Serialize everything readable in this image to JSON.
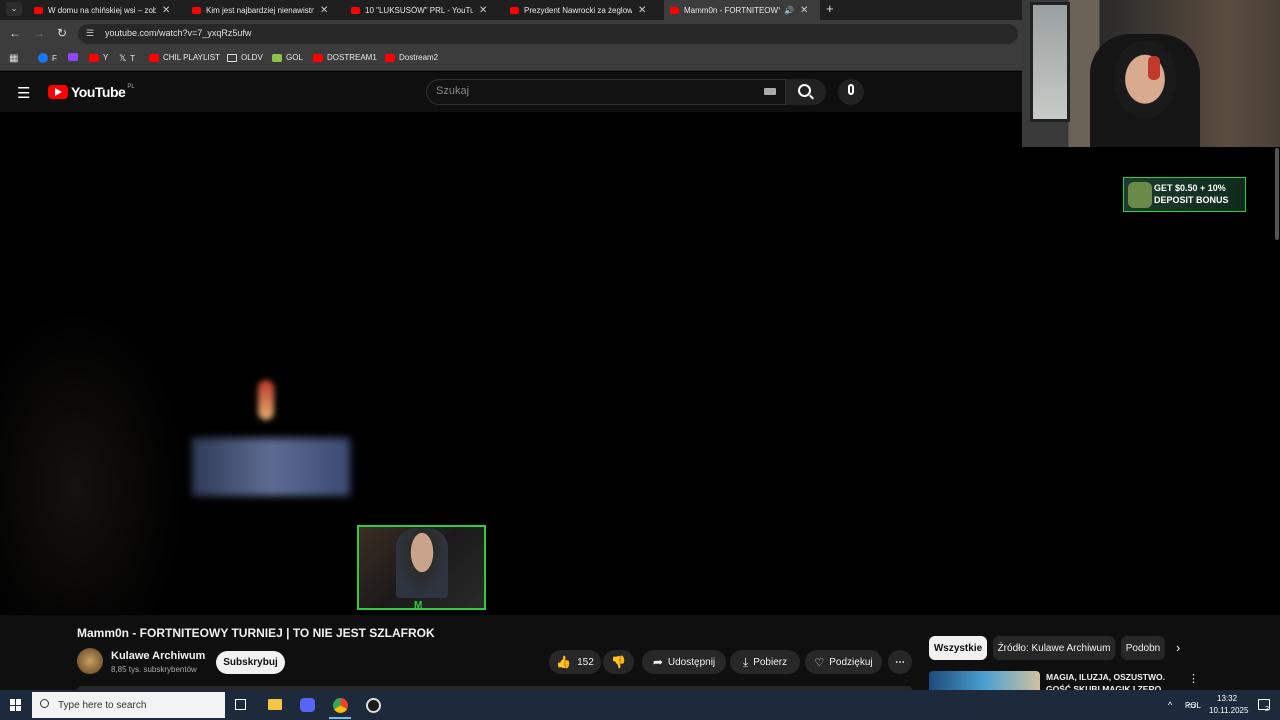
{
  "browser": {
    "tabs": [
      {
        "title": "W domu na chińskiej wsi – zob",
        "active": false
      },
      {
        "title": "Kim jest najbardziej nienawistn",
        "active": false
      },
      {
        "title": "10 \"LUKSUSÓW\" PRL - YouTube",
        "active": false
      },
      {
        "title": "Prezydent Nawrocki za żeglowi",
        "active": false
      },
      {
        "title": "Mamm0n - FORTNITEOWY",
        "active": true
      }
    ],
    "url": "youtube.com/watch?v=7_yxqRz5ufw",
    "bookmarks": [
      {
        "label": "F",
        "color": "#1877f2"
      },
      {
        "label": "",
        "color": "#9146ff"
      },
      {
        "label": "Y",
        "color": "#ff0000"
      },
      {
        "label": "T",
        "color": "#000000"
      },
      {
        "label": "CHIL PLAYLIST",
        "color": "#ff0000"
      },
      {
        "label": "OLDV",
        "color": ""
      },
      {
        "label": "GOL",
        "color": "#8bc34a"
      },
      {
        "label": "DOSTREAM1",
        "color": "#ff0000"
      },
      {
        "label": "Dostream2",
        "color": "#ff0000"
      }
    ]
  },
  "youtube": {
    "logo_text": "YouTube",
    "region": "PL",
    "search_placeholder": "Szukaj",
    "ad_text_line1": "GET $0.50 + 10%",
    "ad_text_line2": "DEPOSIT BONUS",
    "video_title": "Mamm0n - FORTNITEOWY TURNIEJ | TO NIE JEST SZLAFROK",
    "channel_name": "Kulawe Archiwum",
    "subscribers": "8,85 tys. subskrybentów",
    "subscribe_label": "Subskrybuj",
    "likes": "152",
    "share_label": "Udostępnij",
    "download_label": "Pobierz",
    "thanks_label": "Podziękuj",
    "chips": [
      "Wszystkie",
      "Źródło: Kulawe Archiwum",
      "Podobn"
    ],
    "rec_title_line1": "MAGIA, ILUZJA, OSZUSTWO.",
    "rec_title_line2": "GOŚĆ SKUBI MAGIK I ZERO"
  },
  "taskbar": {
    "search_placeholder": "Type here to search",
    "lang": "POL",
    "time": "13:32",
    "date": "10.11.2025",
    "notif_count": "2"
  },
  "colors": {
    "yt_red": "#ff0000",
    "accent_green": "#2ecc40"
  }
}
